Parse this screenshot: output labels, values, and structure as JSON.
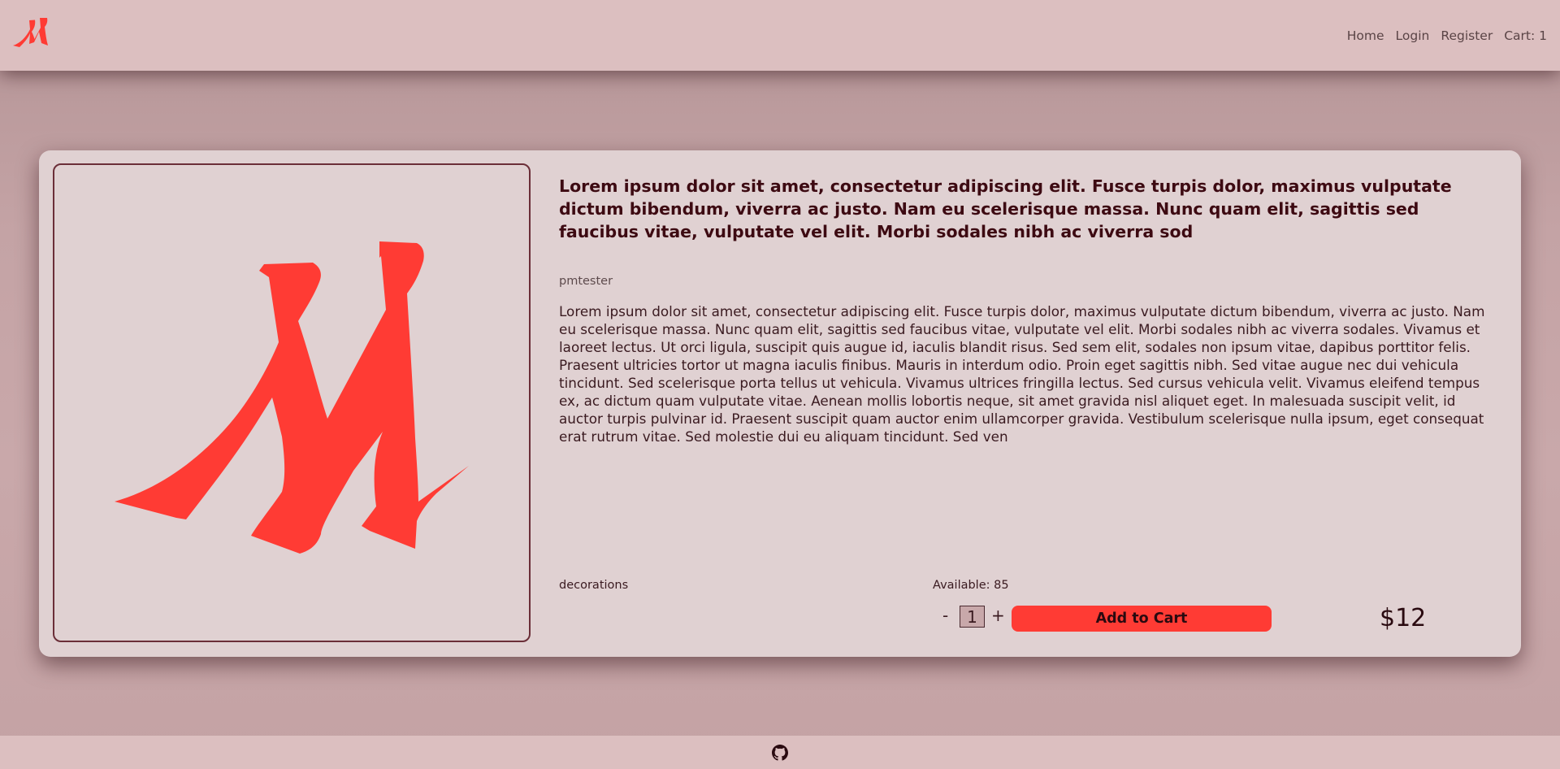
{
  "header": {
    "logo_icon": "brand-logo-icon",
    "nav": [
      "Home",
      "Login",
      "Register",
      "Cart: 1"
    ]
  },
  "product": {
    "image_icon": "brand-logo-image",
    "title": "Lorem ipsum dolor sit amet, consectetur adipiscing elit. Fusce turpis dolor, maximus vulputate dictum bibendum, viverra ac justo. Nam eu scelerisque massa. Nunc quam elit, sagittis sed faucibus vitae, vulputate vel elit. Morbi sodales nibh ac viverra sod",
    "seller": "pmtester",
    "description": "Lorem ipsum dolor sit amet, consectetur adipiscing elit. Fusce turpis dolor, maximus vulputate dictum bibendum, viverra ac justo. Nam eu scelerisque massa. Nunc quam elit, sagittis sed faucibus vitae, vulputate vel elit. Morbi sodales nibh ac viverra sodales. Vivamus et laoreet lectus. Ut orci ligula, suscipit quis augue id, iaculis blandit risus. Sed sem elit, sodales non ipsum vitae, dapibus porttitor felis. Praesent ultricies tortor ut magna iaculis finibus. Mauris in interdum odio. Proin eget sagittis nibh. Sed vitae augue nec dui vehicula tincidunt. Sed scelerisque porta tellus ut vehicula. Vivamus ultrices fringilla lectus. Sed cursus vehicula velit. Vivamus eleifend tempus ex, ac dictum quam vulputate vitae. Aenean mollis lobortis neque, sit amet gravida nisl aliquet eget. In malesuada suscipit velit, id auctor turpis pulvinar id. Praesent suscipit quam auctor enim ullamcorper gravida. Vestibulum scelerisque nulla ipsum, eget consequat erat rutrum vitae. Sed molestie dui eu aliquam tincidunt. Sed ven",
    "category": "decorations",
    "available": "Available: 85",
    "quantity": "1",
    "minus_label": "-",
    "plus_label": "+",
    "add_to_cart_label": "Add to Cart",
    "price": "$12"
  },
  "footer": {
    "icon": "github-icon"
  },
  "colors": {
    "accent": "#ff3b34",
    "card_bg": "#e0d1d2",
    "header_bg": "#dcbfc0",
    "title_text": "#3d0a12"
  }
}
